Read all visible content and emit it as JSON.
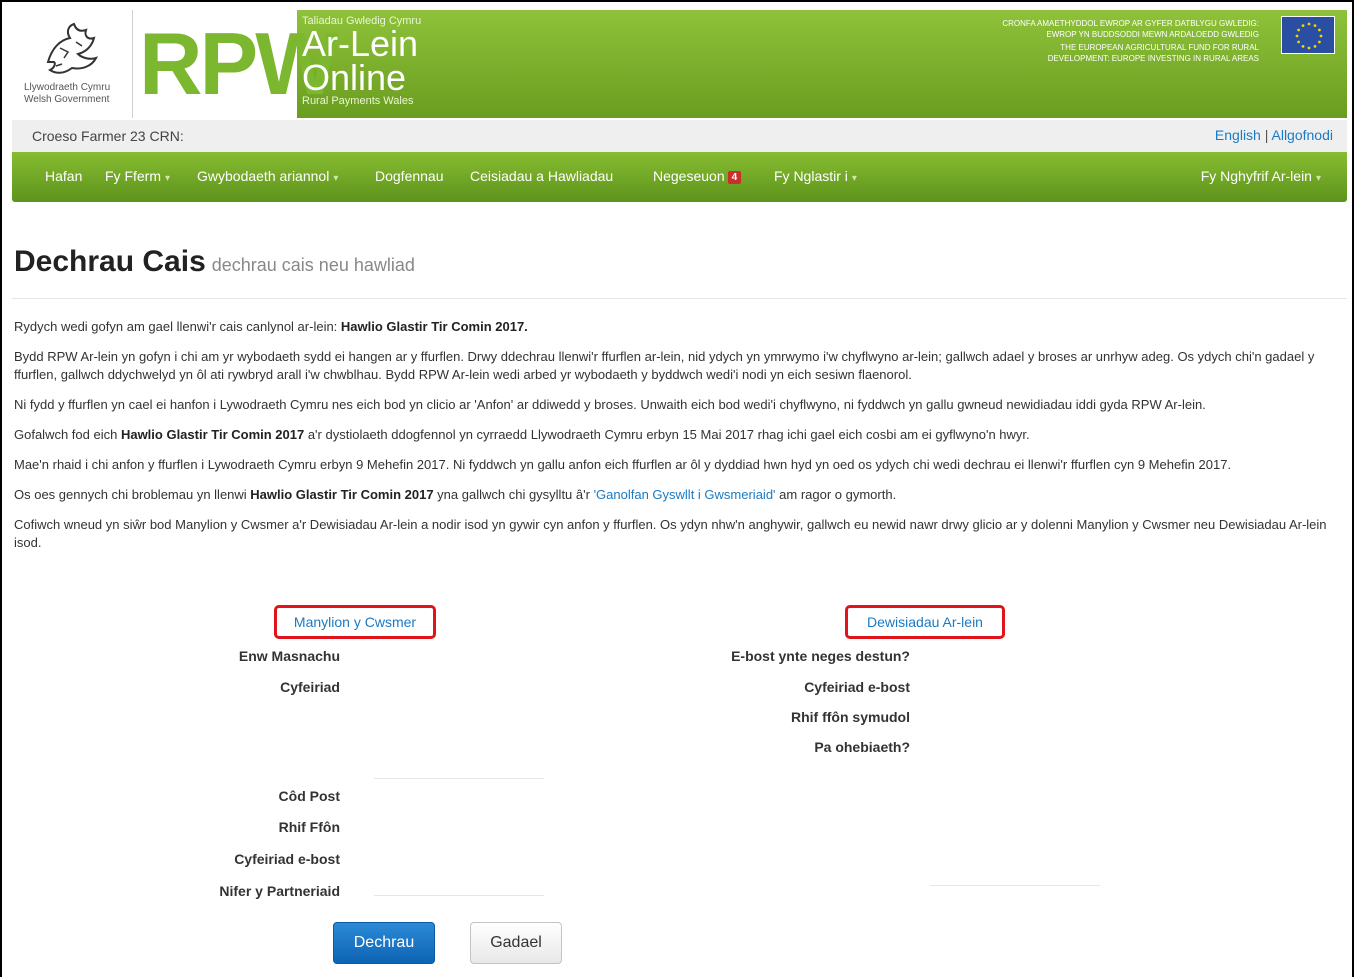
{
  "header": {
    "gov_logo_line1": "Llywodraeth Cymru",
    "gov_logo_line2": "Welsh Government",
    "rpw": "RPW",
    "top_text": "Taliadau Gwledig Cymru",
    "ar_lein": "Ar-Lein",
    "online": "Online",
    "rural_payments": "Rural Payments Wales",
    "eu_welsh": "CRONFA AMAETHYDDOL EWROP AR GYFER DATBLYGU GWLEDIG: EWROP YN BUDDSODDI MEWN ARDALOEDD GWLEDIG",
    "eu_english": "THE EUROPEAN AGRICULTURAL FUND FOR RURAL DEVELOPMENT: EUROPE INVESTING IN RURAL AREAS"
  },
  "welcome": {
    "text": "Croeso Farmer 23 CRN:",
    "english": "English",
    "separator": "|",
    "logout": "Allgofnodi"
  },
  "nav": {
    "items": [
      "Hafan",
      "Fy Fferm",
      "Gwybodaeth ariannol",
      "Dogfennau",
      "Ceisiadau a Hawliadau",
      "Negeseuon",
      "Fy Nglastir i"
    ],
    "messages_count": "4",
    "account": "Fy Nghyfrif Ar-lein"
  },
  "page": {
    "title": "Dechrau Cais",
    "subtitle": "dechrau cais neu hawliad"
  },
  "content": {
    "p1_text": "Rydych wedi gofyn am gael llenwi'r cais canlynol ar-lein: ",
    "p1_bold": "Hawlio Glastir Tir Comin 2017.",
    "p2": "Bydd RPW Ar-lein yn gofyn i chi am yr wybodaeth sydd ei hangen ar y ffurflen. Drwy ddechrau llenwi'r ffurflen ar-lein, nid ydych yn ymrwymo i'w chyflwyno ar-lein; gallwch adael y broses ar unrhyw adeg. Os ydych chi'n gadael y ffurflen, gallwch ddychwelyd yn ôl ati rywbryd arall i'w chwblhau. Bydd RPW Ar-lein wedi arbed yr wybodaeth y byddwch wedi'i nodi yn eich sesiwn flaenorol.",
    "p3": "Ni fydd y ffurflen yn cael ei hanfon i Lywodraeth Cymru nes eich bod yn clicio ar 'Anfon' ar ddiwedd y broses. Unwaith eich bod wedi'i chyflwyno, ni fyddwch yn gallu gwneud newidiadau iddi gyda RPW Ar-lein.",
    "p4_a": "Gofalwch fod eich ",
    "p4_bold": "Hawlio Glastir Tir Comin 2017",
    "p4_b": " a'r dystiolaeth ddogfennol yn cyrraedd Llywodraeth Cymru erbyn 15 Mai 2017 rhag ichi gael eich cosbi am ei gyflwyno'n hwyr.",
    "p5": "Mae'n rhaid i chi anfon y ffurflen i Lywodraeth Cymru erbyn 9 Mehefin 2017. Ni fyddwch yn gallu anfon eich ffurflen ar ôl y dyddiad hwn hyd yn oed os ydych chi wedi dechrau ei llenwi'r ffurflen cyn 9 Mehefin 2017.",
    "p6_a": "Os oes gennych chi broblemau yn llenwi ",
    "p6_bold": "Hawlio Glastir Tir Comin 2017",
    "p6_b": " yna gallwch chi gysylltu â'r ",
    "p6_link": "'Ganolfan Gyswllt i Gwsmeriaid'",
    "p6_c": " am ragor o gymorth.",
    "p7": "Cofiwch wneud yn siŵr bod Manylion y Cwsmer a'r Dewisiadau Ar-lein a nodir isod yn gywir cyn anfon y ffurflen. Os ydyn nhw'n anghywir, gallwch eu newid nawr drwy glicio ar y dolenni Manylion y Cwsmer neu Dewisiadau Ar-lein isod."
  },
  "customer": {
    "link": "Manylion y Cwsmer",
    "labels": [
      "Enw Masnachu",
      "Cyfeiriad",
      "Côd Post",
      "Rhif Ffôn",
      "Cyfeiriad e-bost",
      "Nifer y Partneriaid"
    ]
  },
  "preferences": {
    "link": "Dewisiadau Ar-lein",
    "labels": [
      "E-bost ynte neges destun?",
      "Cyfeiriad e-bost",
      "Rhif ffôn symudol",
      "Pa ohebiaeth?"
    ]
  },
  "buttons": {
    "start": "Dechrau",
    "leave": "Gadael"
  }
}
